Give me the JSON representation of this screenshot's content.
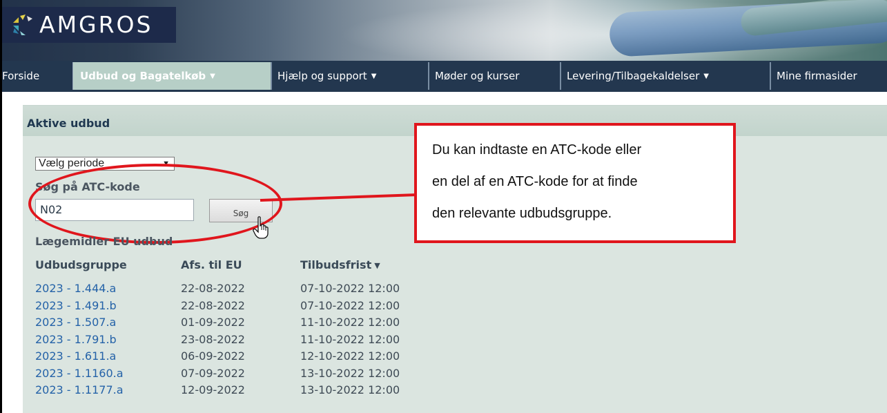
{
  "brand": {
    "name": "AMGROS"
  },
  "nav": {
    "items": [
      {
        "label": "Forside",
        "has_dropdown": false,
        "active": false
      },
      {
        "label": "Udbud og Bagatelkøb",
        "has_dropdown": true,
        "active": true
      },
      {
        "label": "Hjælp og support",
        "has_dropdown": true,
        "active": false
      },
      {
        "label": "Møder og kurser",
        "has_dropdown": false,
        "active": false
      },
      {
        "label": "Levering/Tilbagekaldelser",
        "has_dropdown": true,
        "active": false
      },
      {
        "label": "Mine firmasider",
        "has_dropdown": false,
        "active": false
      }
    ],
    "dropdown_glyph": "▼"
  },
  "panel": {
    "title": "Aktive udbud",
    "period_select": {
      "value": "Vælg periode"
    },
    "atc_label": "Søg på ATC-kode",
    "atc_input_value": "N02",
    "search_button": "Søg",
    "eu_section_label": "Lægemidler EU udbud",
    "table": {
      "columns": [
        "Udbudsgruppe",
        "Afs. til EU",
        "Tilbudsfrist"
      ],
      "sort_column": "Tilbudsfrist",
      "rows": [
        [
          "2023 - 1.444.a",
          "22-08-2022",
          "07-10-2022 12:00"
        ],
        [
          "2023 - 1.491.b",
          "22-08-2022",
          "07-10-2022 12:00"
        ],
        [
          "2023 - 1.507.a",
          "01-09-2022",
          "11-10-2022 12:00"
        ],
        [
          "2023 - 1.791.b",
          "23-08-2022",
          "11-10-2022 12:00"
        ],
        [
          "2023 - 1.611.a",
          "06-09-2022",
          "12-10-2022 12:00"
        ],
        [
          "2023 - 1.1160.a",
          "07-09-2022",
          "13-10-2022 12:00"
        ],
        [
          "2023 - 1.1177.a",
          "12-09-2022",
          "13-10-2022 12:00"
        ]
      ]
    }
  },
  "callout": {
    "lines": [
      "Du kan indtaste en ATC-kode eller",
      "en del af en ATC-kode for at finde",
      "den relevante udbudsgruppe."
    ],
    "color": "#e0161d"
  },
  "colors": {
    "nav_bg": "#23374f",
    "nav_active_bg": "#b7cfc7",
    "panel_bg": "#dbe5e0",
    "link": "#2462a8"
  }
}
